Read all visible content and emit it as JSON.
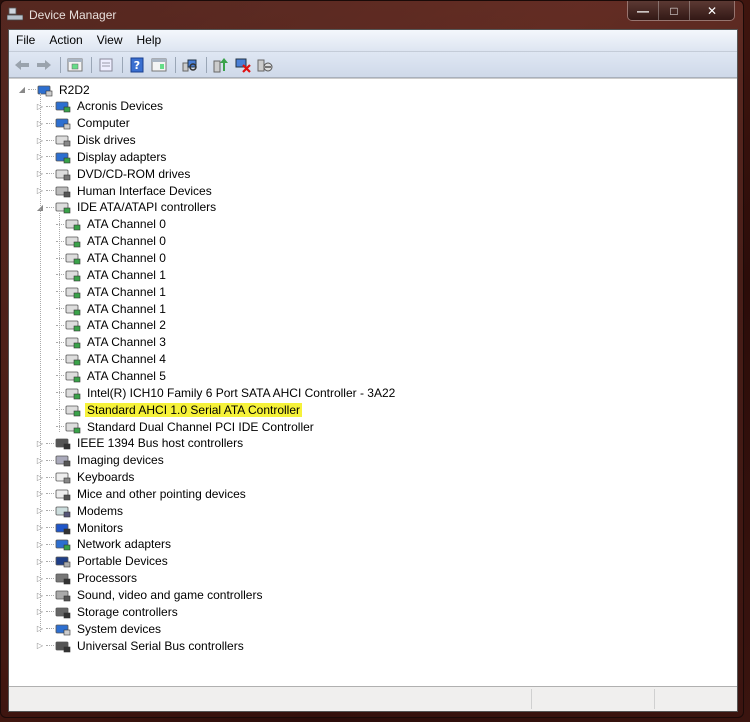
{
  "window": {
    "title": "Device Manager",
    "controls": {
      "minimize": "—",
      "maximize": "□",
      "close": "✕"
    }
  },
  "menu": [
    "File",
    "Action",
    "View",
    "Help"
  ],
  "toolbar": [
    {
      "icon": "back-arrow-icon"
    },
    {
      "icon": "forward-arrow-icon"
    },
    {
      "sep": true
    },
    {
      "icon": "show-hide-console-tree-icon"
    },
    {
      "sep": true
    },
    {
      "icon": "properties-icon"
    },
    {
      "sep": true
    },
    {
      "icon": "help-icon"
    },
    {
      "icon": "show-action-pane-icon"
    },
    {
      "sep": true
    },
    {
      "icon": "scan-hardware-changes-icon"
    },
    {
      "sep": true
    },
    {
      "icon": "update-driver-icon"
    },
    {
      "icon": "uninstall-device-icon"
    },
    {
      "icon": "disable-device-icon"
    }
  ],
  "tree": {
    "root": "R2D2",
    "categories": [
      {
        "label": "Acronis Devices",
        "icon": "acronis-icon"
      },
      {
        "label": "Computer",
        "icon": "computer-icon"
      },
      {
        "label": "Disk drives",
        "icon": "disk-drive-icon"
      },
      {
        "label": "Display adapters",
        "icon": "display-adapter-icon"
      },
      {
        "label": "DVD/CD-ROM drives",
        "icon": "dvd-drive-icon"
      },
      {
        "label": "Human Interface Devices",
        "icon": "hid-icon"
      },
      {
        "label": "IDE ATA/ATAPI controllers",
        "icon": "ide-controller-icon",
        "expanded": true,
        "children": [
          {
            "label": "ATA Channel 0"
          },
          {
            "label": "ATA Channel 0"
          },
          {
            "label": "ATA Channel 0"
          },
          {
            "label": "ATA Channel 1"
          },
          {
            "label": "ATA Channel 1"
          },
          {
            "label": "ATA Channel 1"
          },
          {
            "label": "ATA Channel 2"
          },
          {
            "label": "ATA Channel 3"
          },
          {
            "label": "ATA Channel 4"
          },
          {
            "label": "ATA Channel 5"
          },
          {
            "label": "Intel(R) ICH10 Family 6 Port SATA AHCI Controller - 3A22"
          },
          {
            "label": "Standard AHCI 1.0 Serial ATA Controller",
            "highlighted": true
          },
          {
            "label": "Standard Dual Channel PCI IDE Controller"
          }
        ]
      },
      {
        "label": "IEEE 1394 Bus host controllers",
        "icon": "ieee1394-icon"
      },
      {
        "label": "Imaging devices",
        "icon": "imaging-icon"
      },
      {
        "label": "Keyboards",
        "icon": "keyboard-icon"
      },
      {
        "label": "Mice and other pointing devices",
        "icon": "mouse-icon"
      },
      {
        "label": "Modems",
        "icon": "modem-icon"
      },
      {
        "label": "Monitors",
        "icon": "monitor-icon"
      },
      {
        "label": "Network adapters",
        "icon": "network-adapter-icon"
      },
      {
        "label": "Portable Devices",
        "icon": "portable-device-icon"
      },
      {
        "label": "Processors",
        "icon": "processor-icon"
      },
      {
        "label": "Sound, video and game controllers",
        "icon": "sound-icon"
      },
      {
        "label": "Storage controllers",
        "icon": "storage-controller-icon"
      },
      {
        "label": "System devices",
        "icon": "system-device-icon"
      },
      {
        "label": "Universal Serial Bus controllers",
        "icon": "usb-icon"
      }
    ]
  },
  "colors": {
    "highlight": "#f6f23a",
    "menubar": "#dde5f1"
  }
}
